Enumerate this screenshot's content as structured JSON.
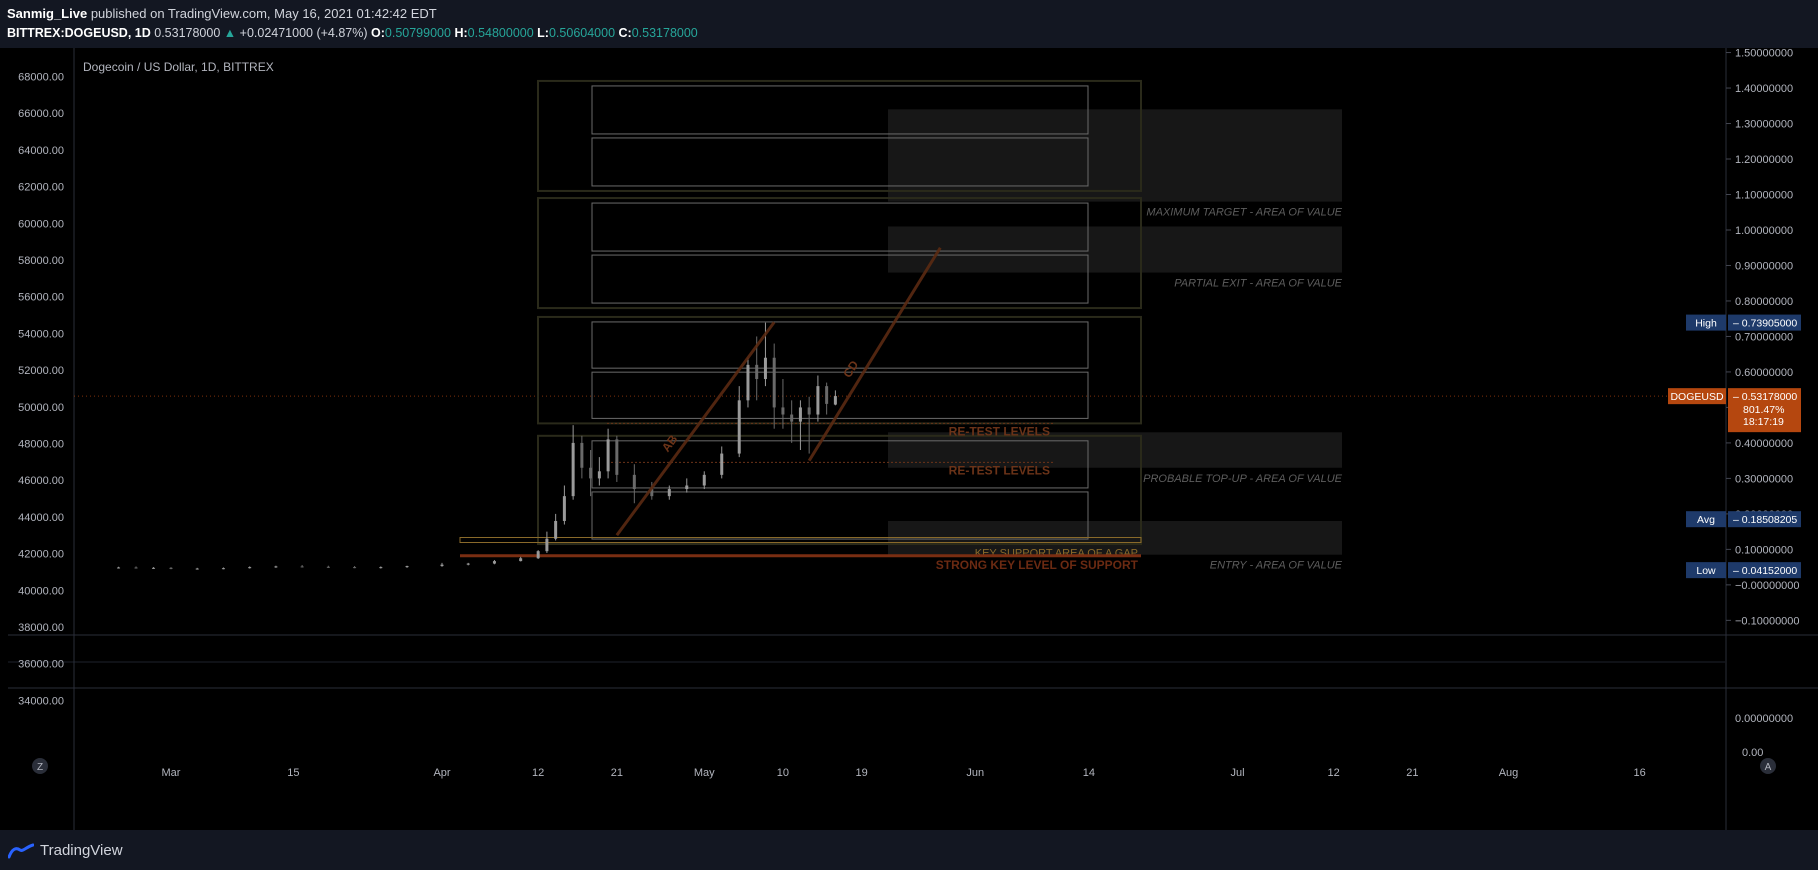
{
  "header": {
    "author": "Sanmig_Live",
    "published_text": "published on TradingView.com, May 16, 2021 01:42:42 EDT",
    "symbol": "BITTREX:DOGEUSD, 1D",
    "last": "0.53178000",
    "change": "+0.02471000 (+4.87%)",
    "o_label": "O:",
    "o_value": "0.50799000",
    "h_label": "H:",
    "h_value": "0.54800000",
    "l_label": "L:",
    "l_value": "0.50604000",
    "c_label": "C:",
    "c_value": "0.53178000"
  },
  "footer": {
    "brand": "TradingView",
    "logo_icon": "tradingview-logo-icon"
  },
  "colors": {
    "background": "#000000",
    "chrome": "#131722",
    "box_outline": "#2a2a1a",
    "inner_box": "#6a6a6a",
    "retest": "#6b3318",
    "gap_line": "#8a6a2a",
    "strong_line": "#7a2e12",
    "tag_blue": "#1e3a6a",
    "tag_orange": "#b5470f"
  },
  "buttons": {
    "left_circle": "Z",
    "right_circle": "A"
  },
  "chart_data": {
    "type": "candlestick",
    "title": "Dogecoin / US Dollar, 1D, BITTREX",
    "left_axis": {
      "labels": [
        "68000.00",
        "66000.00",
        "64000.00",
        "62000.00",
        "60000.00",
        "58000.00",
        "56000.00",
        "54000.00",
        "52000.00",
        "50000.00",
        "48000.00",
        "46000.00",
        "44000.00",
        "42000.00",
        "40000.00",
        "38000.00",
        "36000.00",
        "34000.00"
      ],
      "range": [
        33000,
        68800
      ]
    },
    "right_axis": {
      "labels": [
        "1.50000000",
        "1.40000000",
        "1.30000000",
        "1.20000000",
        "1.10000000",
        "1.00000000",
        "0.90000000",
        "0.80000000",
        "0.70000000",
        "0.60000000",
        "0.50000000",
        "0.40000000",
        "0.30000000",
        "0.20000000",
        "0.10000000",
        "−0.00000000",
        "−0.10000000"
      ],
      "values": [
        1.5,
        1.4,
        1.3,
        1.2,
        1.1,
        1.0,
        0.9,
        0.8,
        0.7,
        0.6,
        0.5,
        0.4,
        0.3,
        0.2,
        0.1,
        0.0,
        -0.1
      ],
      "range": [
        -0.13,
        1.51
      ]
    },
    "lower_pane": {
      "labels": [
        "0.00000000",
        "0.00"
      ]
    },
    "x_axis": {
      "labels": [
        "Mar",
        "15",
        "Apr",
        "12",
        "21",
        "May",
        "10",
        "19",
        "Jun",
        "14",
        "Jul",
        "12",
        "21",
        "Aug",
        "16"
      ],
      "dates": [
        "2021-03-01",
        "2021-03-15",
        "2021-04-01",
        "2021-04-12",
        "2021-04-21",
        "2021-05-01",
        "2021-05-10",
        "2021-05-19",
        "2021-06-01",
        "2021-06-14",
        "2021-07-01",
        "2021-07-12",
        "2021-07-21",
        "2021-08-01",
        "2021-08-16"
      ]
    },
    "price_tags": [
      {
        "label": "High",
        "value": "0.73905000",
        "y": 0.73905,
        "style": "blue"
      },
      {
        "label": "DOGEUSD",
        "value": "0.53178000",
        "extra": [
          "801.47%",
          "18:17:19"
        ],
        "y": 0.53178,
        "style": "orange"
      },
      {
        "label": "Avg",
        "value": "0.18508205",
        "y": 0.18508,
        "style": "blue"
      },
      {
        "label": "Low",
        "value": "0.04152000",
        "y": 0.04152,
        "style": "blue"
      }
    ],
    "candles": [
      {
        "d": "2021-02-23",
        "o": 0.048,
        "h": 0.051,
        "l": 0.046,
        "c": 0.049
      },
      {
        "d": "2021-02-25",
        "o": 0.049,
        "h": 0.052,
        "l": 0.046,
        "c": 0.047
      },
      {
        "d": "2021-02-27",
        "o": 0.047,
        "h": 0.05,
        "l": 0.045,
        "c": 0.048
      },
      {
        "d": "2021-03-01",
        "o": 0.048,
        "h": 0.05,
        "l": 0.044,
        "c": 0.045
      },
      {
        "d": "2021-03-04",
        "o": 0.045,
        "h": 0.048,
        "l": 0.043,
        "c": 0.046
      },
      {
        "d": "2021-03-07",
        "o": 0.046,
        "h": 0.049,
        "l": 0.044,
        "c": 0.047
      },
      {
        "d": "2021-03-10",
        "o": 0.047,
        "h": 0.052,
        "l": 0.046,
        "c": 0.05
      },
      {
        "d": "2021-03-13",
        "o": 0.05,
        "h": 0.054,
        "l": 0.048,
        "c": 0.052
      },
      {
        "d": "2021-03-16",
        "o": 0.052,
        "h": 0.056,
        "l": 0.049,
        "c": 0.051
      },
      {
        "d": "2021-03-19",
        "o": 0.051,
        "h": 0.054,
        "l": 0.048,
        "c": 0.05
      },
      {
        "d": "2021-03-22",
        "o": 0.05,
        "h": 0.053,
        "l": 0.047,
        "c": 0.049
      },
      {
        "d": "2021-03-25",
        "o": 0.049,
        "h": 0.052,
        "l": 0.046,
        "c": 0.05
      },
      {
        "d": "2021-03-28",
        "o": 0.05,
        "h": 0.054,
        "l": 0.048,
        "c": 0.053
      },
      {
        "d": "2021-04-01",
        "o": 0.053,
        "h": 0.062,
        "l": 0.051,
        "c": 0.057
      },
      {
        "d": "2021-04-04",
        "o": 0.057,
        "h": 0.062,
        "l": 0.055,
        "c": 0.06
      },
      {
        "d": "2021-04-07",
        "o": 0.06,
        "h": 0.07,
        "l": 0.058,
        "c": 0.067
      },
      {
        "d": "2021-04-10",
        "o": 0.067,
        "h": 0.079,
        "l": 0.066,
        "c": 0.075
      },
      {
        "d": "2021-04-12",
        "o": 0.075,
        "h": 0.098,
        "l": 0.073,
        "c": 0.095
      },
      {
        "d": "2021-04-13",
        "o": 0.095,
        "h": 0.15,
        "l": 0.09,
        "c": 0.13
      },
      {
        "d": "2021-04-14",
        "o": 0.13,
        "h": 0.2,
        "l": 0.125,
        "c": 0.18
      },
      {
        "d": "2021-04-15",
        "o": 0.18,
        "h": 0.28,
        "l": 0.17,
        "c": 0.25
      },
      {
        "d": "2021-04-16",
        "o": 0.25,
        "h": 0.45,
        "l": 0.24,
        "c": 0.4
      },
      {
        "d": "2021-04-17",
        "o": 0.4,
        "h": 0.42,
        "l": 0.3,
        "c": 0.33
      },
      {
        "d": "2021-04-18",
        "o": 0.33,
        "h": 0.38,
        "l": 0.25,
        "c": 0.3
      },
      {
        "d": "2021-04-19",
        "o": 0.3,
        "h": 0.36,
        "l": 0.28,
        "c": 0.32
      },
      {
        "d": "2021-04-20",
        "o": 0.32,
        "h": 0.44,
        "l": 0.3,
        "c": 0.41
      },
      {
        "d": "2021-04-21",
        "o": 0.41,
        "h": 0.42,
        "l": 0.29,
        "c": 0.31
      },
      {
        "d": "2021-04-23",
        "o": 0.31,
        "h": 0.34,
        "l": 0.23,
        "c": 0.27
      },
      {
        "d": "2021-04-25",
        "o": 0.27,
        "h": 0.29,
        "l": 0.24,
        "c": 0.25
      },
      {
        "d": "2021-04-27",
        "o": 0.25,
        "h": 0.28,
        "l": 0.24,
        "c": 0.27
      },
      {
        "d": "2021-04-29",
        "o": 0.27,
        "h": 0.3,
        "l": 0.26,
        "c": 0.28
      },
      {
        "d": "2021-05-01",
        "o": 0.28,
        "h": 0.32,
        "l": 0.27,
        "c": 0.31
      },
      {
        "d": "2021-05-03",
        "o": 0.31,
        "h": 0.39,
        "l": 0.3,
        "c": 0.37
      },
      {
        "d": "2021-05-05",
        "o": 0.37,
        "h": 0.56,
        "l": 0.36,
        "c": 0.52
      },
      {
        "d": "2021-05-06",
        "o": 0.52,
        "h": 0.64,
        "l": 0.5,
        "c": 0.62
      },
      {
        "d": "2021-05-07",
        "o": 0.62,
        "h": 0.7,
        "l": 0.52,
        "c": 0.58
      },
      {
        "d": "2021-05-08",
        "o": 0.58,
        "h": 0.739,
        "l": 0.56,
        "c": 0.64
      },
      {
        "d": "2021-05-09",
        "o": 0.64,
        "h": 0.68,
        "l": 0.44,
        "c": 0.5
      },
      {
        "d": "2021-05-10",
        "o": 0.5,
        "h": 0.58,
        "l": 0.44,
        "c": 0.48
      },
      {
        "d": "2021-05-11",
        "o": 0.48,
        "h": 0.52,
        "l": 0.4,
        "c": 0.46
      },
      {
        "d": "2021-05-12",
        "o": 0.46,
        "h": 0.52,
        "l": 0.38,
        "c": 0.5
      },
      {
        "d": "2021-05-13",
        "o": 0.5,
        "h": 0.53,
        "l": 0.37,
        "c": 0.48
      },
      {
        "d": "2021-05-14",
        "o": 0.48,
        "h": 0.59,
        "l": 0.46,
        "c": 0.56
      },
      {
        "d": "2021-05-15",
        "o": 0.56,
        "h": 0.57,
        "l": 0.48,
        "c": 0.51
      },
      {
        "d": "2021-05-16",
        "o": 0.508,
        "h": 0.548,
        "l": 0.506,
        "c": 0.532
      }
    ],
    "zones": [
      {
        "label": "MAXIMUM TARGET - AREA OF VALUE",
        "top": 1.34,
        "bottom": 1.08
      },
      {
        "label": "PARTIAL EXIT - AREA OF VALUE",
        "top": 1.01,
        "bottom": 0.88
      },
      {
        "label": "PROBABLE TOP-UP - AREA OF VALUE",
        "top": 0.43,
        "bottom": 0.33
      },
      {
        "label": "ENTRY - AREA OF VALUE",
        "top": 0.18,
        "bottom": 0.085
      }
    ],
    "levels": [
      {
        "label": "RE-TEST LEVELS",
        "y": 0.455
      },
      {
        "label": "RE-TEST LEVELS",
        "y": 0.345
      },
      {
        "label": "KEY SUPPORT AREA OF A GAP",
        "y": 0.125
      },
      {
        "label": "STRONG KEY LEVEL OF SUPPORT",
        "y": 0.082
      }
    ],
    "trend_lines": [
      {
        "label": "AB",
        "from": [
          "2021-04-21",
          0.14
        ],
        "to": [
          "2021-05-09",
          0.74
        ]
      },
      {
        "label": "CD",
        "from": [
          "2021-05-13",
          0.35
        ],
        "to": [
          "2021-05-28",
          0.95
        ]
      }
    ],
    "current_price": 0.53178
  }
}
